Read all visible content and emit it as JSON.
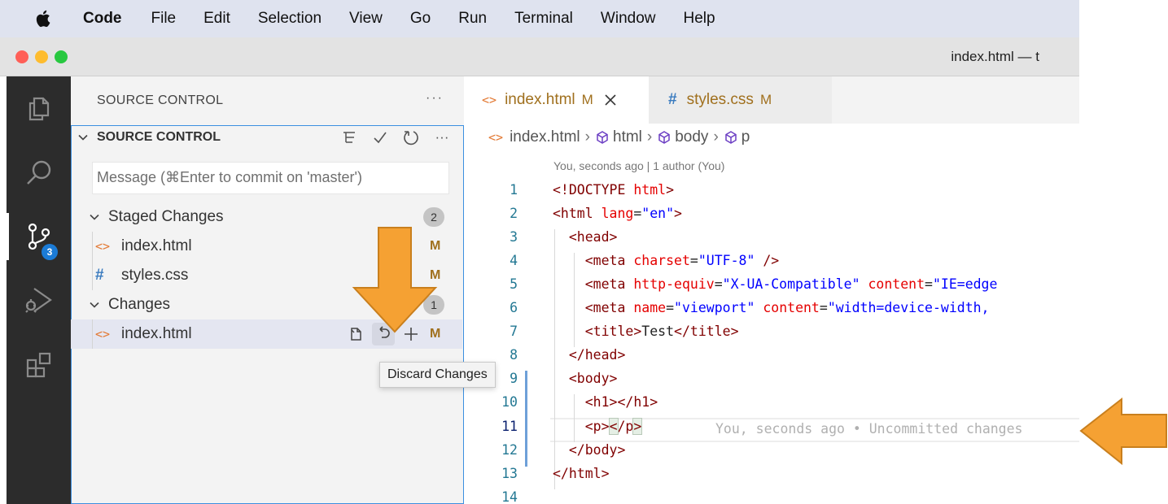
{
  "menubar": {
    "app": "Code",
    "items": [
      "File",
      "Edit",
      "Selection",
      "View",
      "Go",
      "Run",
      "Terminal",
      "Window",
      "Help"
    ]
  },
  "window": {
    "title": "index.html — t"
  },
  "activity_bar": {
    "items": [
      "explorer-icon",
      "search-icon",
      "source-control-icon",
      "run-debug-icon",
      "extensions-icon"
    ],
    "source_control_badge": "3"
  },
  "sidebar": {
    "header": "SOURCE CONTROL",
    "more": "···",
    "section_title": "SOURCE CONTROL",
    "commit_placeholder": "Message (⌘Enter to commit on 'master')",
    "staged": {
      "label": "Staged Changes",
      "count": "2",
      "files": [
        {
          "name": "index.html",
          "status": "M",
          "icon": "<>"
        },
        {
          "name": "styles.css",
          "status": "M",
          "icon": "#"
        }
      ]
    },
    "changes": {
      "label": "Changes",
      "count": "1",
      "files": [
        {
          "name": "index.html",
          "status": "M",
          "icon": "<>"
        }
      ]
    },
    "tooltip": "Discard Changes"
  },
  "tabs": [
    {
      "name": "index.html",
      "status": "M",
      "icon": "<>",
      "active": true
    },
    {
      "name": "styles.css",
      "status": "M",
      "icon": "#",
      "active": false
    }
  ],
  "breadcrumb": [
    "index.html",
    "html",
    "body",
    "p"
  ],
  "editor": {
    "blame_header": "You, seconds ago | 1 author (You)",
    "line_numbers": [
      "1",
      "2",
      "3",
      "4",
      "5",
      "6",
      "7",
      "8",
      "9",
      "10",
      "11",
      "12",
      "13",
      "14"
    ],
    "inline_blame": "You, seconds ago • Uncommitted changes",
    "current_line": "11"
  },
  "colors": {
    "accent": "#1b7bd6",
    "modified": "#a0701e",
    "annotation_arrow": "#f5a133"
  }
}
